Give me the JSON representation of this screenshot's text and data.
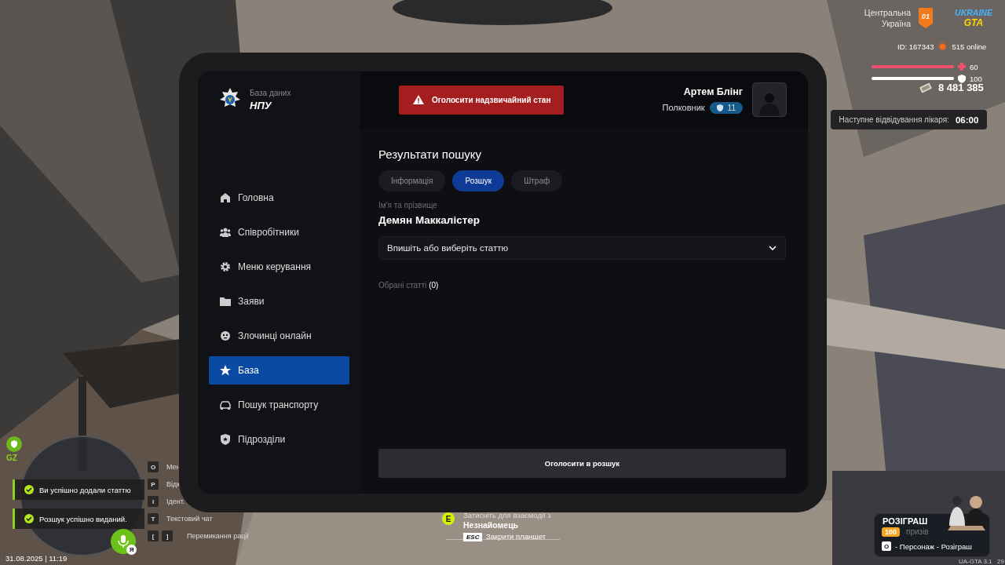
{
  "hud": {
    "region_lines": [
      "Центральна",
      "Україна"
    ],
    "region_badge": "01",
    "logo_lines": [
      "UKRAINE",
      "GTA"
    ],
    "player_id": "ID: 167343",
    "online": "515 online",
    "health": {
      "level": 1,
      "reading": "60"
    },
    "armor": {
      "level": 1,
      "reading": "100"
    },
    "money": "8 481 385",
    "doctor": {
      "label": "Наступне відвідування лікаря:",
      "time": "06:00"
    }
  },
  "zone": "GZ",
  "notifications": [
    {
      "text": "Ви успішно додали статтю"
    },
    {
      "text": "Розшук успішно виданий."
    }
  ],
  "keybinds": [
    {
      "keys": [
        "O"
      ],
      "label": "Мен"
    },
    {
      "keys": [
        "P"
      ],
      "label": "Відк"
    },
    {
      "keys": [
        "I"
      ],
      "label": "Ідент."
    },
    {
      "keys": [
        "T"
      ],
      "label": "Текстовий чат"
    },
    {
      "keys": [
        "[",
        "]"
      ],
      "label": "Перемикання рації"
    }
  ],
  "voice_badge": "Я",
  "datetime": "31.08.2025 | 11:19",
  "interaction": {
    "key": "E",
    "hint": "Затисніть для взаємодії з",
    "target": "Незнайомець",
    "close_key": "ESC",
    "close_label": "Закрити планшет"
  },
  "promo": {
    "title": "РОЗІГРАШ",
    "count": "100",
    "count_label": "призів",
    "key": "O",
    "path": "- Персонаж - Розіграш"
  },
  "version": "UA-GTA 3.1",
  "corner_number": "29",
  "tablet": {
    "brand": {
      "subtitle": "База даних",
      "title": "НПУ"
    },
    "emergency_button": "Оголосити надзвичайний стан",
    "user": {
      "name": "Артем Блінг",
      "rank": "Полковник",
      "level": "11"
    },
    "nav": [
      {
        "label": "Головна",
        "selected": false
      },
      {
        "label": "Співробітники",
        "selected": false
      },
      {
        "label": "Меню керування",
        "selected": false
      },
      {
        "label": "Заяви",
        "selected": false
      },
      {
        "label": "Злочинці онлайн",
        "selected": false
      },
      {
        "label": "База",
        "selected": true
      },
      {
        "label": "Пошук транспорту",
        "selected": false
      },
      {
        "label": "Підрозділи",
        "selected": false
      }
    ],
    "heading": "Результати пошуку",
    "tabs": [
      {
        "label": "Інформація",
        "selected": false
      },
      {
        "label": "Розшук",
        "selected": true
      },
      {
        "label": "Штраф",
        "selected": false
      }
    ],
    "field_label": "Ім'я та прізвище",
    "person": "Демян Маккалістер",
    "article_select": {
      "placeholder": "Впишіть або виберіть статтю"
    },
    "selected_articles": {
      "label": "Обрані статті",
      "count": "(0)"
    },
    "submit_button": "Оголосити в розшук"
  }
}
